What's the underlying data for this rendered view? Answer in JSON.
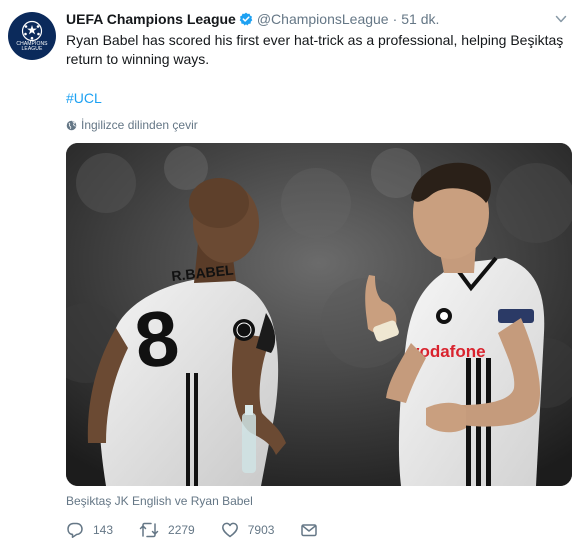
{
  "tweet": {
    "display_name": "UEFA Champions League",
    "handle": "@ChampionsLeague",
    "separator": "·",
    "timestamp": "51 dk.",
    "verified": true,
    "avatar_text_1": "CHAMPIONS",
    "avatar_text_2": "LEAGUE",
    "text": "Ryan Babel has scored his first ever hat-trick as a professional, helping Beşiktaş return to winning ways.",
    "hashtag": "#UCL",
    "translate_label": "İngilizce dilinden çevir",
    "media_tags": "Beşiktaş JK English ve Ryan Babel",
    "photo_text": {
      "player_left_name": "R.BABEL",
      "player_left_number": "8",
      "player_right_sponsor": "vodafone"
    }
  },
  "actions": {
    "reply_count": "143",
    "retweet_count": "2279",
    "like_count": "7903"
  },
  "icons": {
    "verified": "verified-badge-icon",
    "caret": "chevron-down-icon",
    "globe": "globe-icon",
    "reply": "reply-icon",
    "retweet": "retweet-icon",
    "like": "heart-icon",
    "dm": "envelope-icon"
  },
  "colors": {
    "accent": "#1da1f2",
    "secondary_text": "#657786",
    "avatar_bg": "#0b2a5b"
  }
}
